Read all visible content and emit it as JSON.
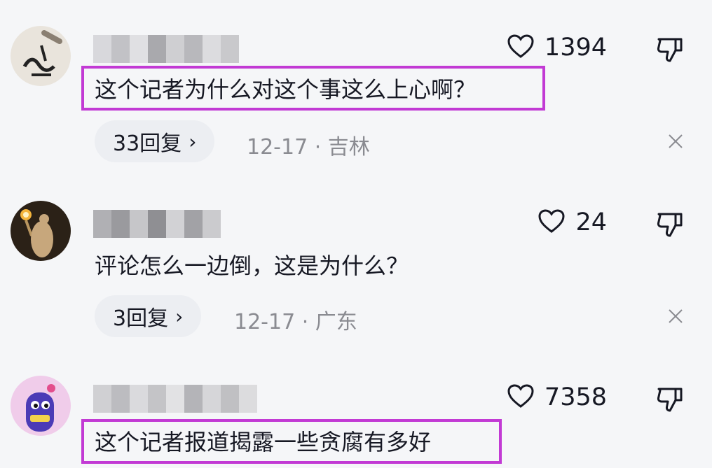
{
  "comments": [
    {
      "text": "这个记者为什么对这个事这么上心啊？",
      "like_count": "1394",
      "reply_label": "33回复",
      "meta": "12-17 · 吉林",
      "highlighted": true
    },
    {
      "text": "评论怎么一边倒，这是为什么？",
      "like_count": "24",
      "reply_label": "3回复",
      "meta": "12-17 · 广东",
      "highlighted": false
    },
    {
      "text": "这个记者报道揭露一些贪腐有多好",
      "like_count": "7358",
      "highlighted": true
    }
  ],
  "colors": {
    "highlight": "#c23ad4",
    "background": "#f5f6f8"
  },
  "icons": [
    "heart-icon",
    "thumbs-down-icon",
    "close-icon",
    "chevron-right-icon"
  ]
}
